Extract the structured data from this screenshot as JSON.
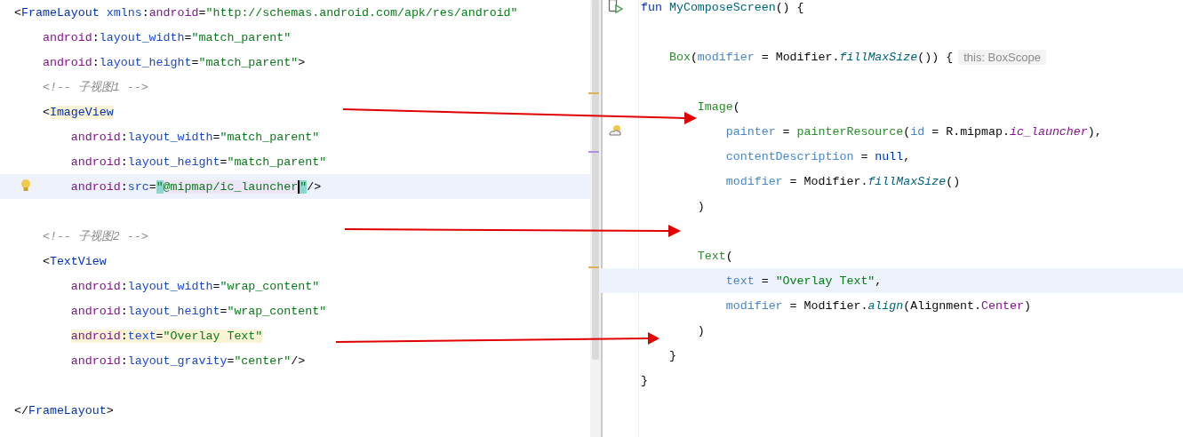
{
  "xml_editor": {
    "lines": [
      {
        "current": false,
        "marked": false,
        "tokens": [
          {
            "kind": "p",
            "text": "<"
          },
          {
            "kind": "tag",
            "text": "FrameLayout"
          },
          {
            "kind": "ns",
            "text": " xmlns"
          },
          {
            "kind": "p",
            "text": ":"
          },
          {
            "kind": "attr_ns",
            "text": "android"
          },
          {
            "kind": "p",
            "text": "="
          },
          {
            "kind": "str",
            "text": "\"http://schemas.android.com/apk/res/android\""
          }
        ]
      },
      {
        "current": false,
        "marked": false,
        "tokens": [
          {
            "kind": "attr_ns",
            "text": "    android"
          },
          {
            "kind": "p",
            "text": ":"
          },
          {
            "kind": "attr",
            "text": "layout_width"
          },
          {
            "kind": "p",
            "text": "="
          },
          {
            "kind": "str",
            "text": "\"match_parent\""
          }
        ]
      },
      {
        "current": false,
        "marked": false,
        "tokens": [
          {
            "kind": "attr_ns",
            "text": "    android"
          },
          {
            "kind": "p",
            "text": ":"
          },
          {
            "kind": "attr",
            "text": "layout_height"
          },
          {
            "kind": "p",
            "text": "="
          },
          {
            "kind": "str",
            "text": "\"match_parent\""
          },
          {
            "kind": "p",
            "text": ">"
          }
        ]
      },
      {
        "current": false,
        "marked": false,
        "tokens": [
          {
            "kind": "cm",
            "text": "    <!-- 子视图1 -->"
          }
        ]
      },
      {
        "current": false,
        "marked": true,
        "tokens": [
          {
            "kind": "p",
            "text": "    <"
          },
          {
            "kind": "tag",
            "text": "ImageView"
          }
        ]
      },
      {
        "current": false,
        "marked": false,
        "tokens": [
          {
            "kind": "attr_ns",
            "text": "        android"
          },
          {
            "kind": "p",
            "text": ":"
          },
          {
            "kind": "attr",
            "text": "layout_width"
          },
          {
            "kind": "p",
            "text": "="
          },
          {
            "kind": "str",
            "text": "\"match_parent\""
          }
        ]
      },
      {
        "current": false,
        "marked": false,
        "tokens": [
          {
            "kind": "attr_ns",
            "text": "        android"
          },
          {
            "kind": "p",
            "text": ":"
          },
          {
            "kind": "attr",
            "text": "layout_height"
          },
          {
            "kind": "p",
            "text": "="
          },
          {
            "kind": "str",
            "text": "\"match_parent\""
          }
        ]
      },
      {
        "current": true,
        "marked": false,
        "tokens": [
          {
            "kind": "attr_ns",
            "text": "        android"
          },
          {
            "kind": "p",
            "text": ":"
          },
          {
            "kind": "attr",
            "text": "src"
          },
          {
            "kind": "p",
            "text": "="
          },
          {
            "kind": "str_q",
            "text": "\""
          },
          {
            "kind": "str_sel",
            "text": "@mipmap/ic_launcher"
          },
          {
            "kind": "str_q",
            "text": "\""
          },
          {
            "kind": "p",
            "text": "/>"
          }
        ]
      },
      {
        "current": false
      },
      {
        "current": false,
        "marked": false,
        "tokens": [
          {
            "kind": "cm",
            "text": "    <!-- 子视图2 -->"
          }
        ]
      },
      {
        "current": false,
        "marked": false,
        "tokens": [
          {
            "kind": "p",
            "text": "    <"
          },
          {
            "kind": "tag",
            "text": "TextView"
          }
        ]
      },
      {
        "current": false,
        "marked": false,
        "tokens": [
          {
            "kind": "attr_ns",
            "text": "        android"
          },
          {
            "kind": "p",
            "text": ":"
          },
          {
            "kind": "attr",
            "text": "layout_width"
          },
          {
            "kind": "p",
            "text": "="
          },
          {
            "kind": "str",
            "text": "\"wrap_content\""
          }
        ]
      },
      {
        "current": false,
        "marked": false,
        "tokens": [
          {
            "kind": "attr_ns",
            "text": "        android"
          },
          {
            "kind": "p",
            "text": ":"
          },
          {
            "kind": "attr",
            "text": "layout_height"
          },
          {
            "kind": "p",
            "text": "="
          },
          {
            "kind": "str",
            "text": "\"wrap_content\""
          }
        ]
      },
      {
        "current": false,
        "marked": true,
        "tokens": [
          {
            "kind": "attr_ns",
            "text": "        android"
          },
          {
            "kind": "p",
            "text": ":"
          },
          {
            "kind": "attr",
            "text": "text"
          },
          {
            "kind": "p",
            "text": "="
          },
          {
            "kind": "str",
            "text": "\"Overlay Text\""
          }
        ]
      },
      {
        "current": false,
        "marked": false,
        "tokens": [
          {
            "kind": "attr_ns",
            "text": "        android"
          },
          {
            "kind": "p",
            "text": ":"
          },
          {
            "kind": "attr",
            "text": "layout_gravity"
          },
          {
            "kind": "p",
            "text": "="
          },
          {
            "kind": "str",
            "text": "\"center\""
          },
          {
            "kind": "p",
            "text": "/>"
          }
        ]
      },
      {
        "current": false
      },
      {
        "current": false,
        "marked": false,
        "tokens": [
          {
            "kind": "p",
            "text": "</"
          },
          {
            "kind": "tag",
            "text": "FrameLayout"
          },
          {
            "kind": "p",
            "text": ">"
          }
        ]
      }
    ]
  },
  "kotlin_editor": {
    "lines": [
      {
        "current": false,
        "tokens": [
          {
            "kind": "kw",
            "text": "fun"
          },
          {
            "kind": "fn",
            "text": " MyComposeScreen"
          },
          {
            "kind": "p",
            "text": "() {"
          }
        ]
      },
      {
        "current": false
      },
      {
        "current": false,
        "tokens": [
          {
            "kind": "call",
            "text": "    Box"
          },
          {
            "kind": "p",
            "text": "("
          },
          {
            "kind": "param",
            "text": "modifier"
          },
          {
            "kind": "p",
            "text": " = Modifier."
          },
          {
            "kind": "it",
            "text": "fillMaxSize"
          },
          {
            "kind": "p",
            "text": "()) {"
          }
        ],
        "hint": "this: BoxScope"
      },
      {
        "current": false
      },
      {
        "current": false,
        "tokens": [
          {
            "kind": "call",
            "text": "        Image"
          },
          {
            "kind": "p",
            "text": "("
          }
        ]
      },
      {
        "current": false,
        "tokens": [
          {
            "kind": "param",
            "text": "            painter"
          },
          {
            "kind": "p",
            "text": " = "
          },
          {
            "kind": "call",
            "text": "painterResource"
          },
          {
            "kind": "p",
            "text": "("
          },
          {
            "kind": "param",
            "text": "id"
          },
          {
            "kind": "p",
            "text": " = R.mipmap."
          },
          {
            "kind": "itp",
            "text": "ic_launcher"
          },
          {
            "kind": "p",
            "text": "),"
          }
        ]
      },
      {
        "current": false,
        "tokens": [
          {
            "kind": "param",
            "text": "            contentDescription"
          },
          {
            "kind": "p",
            "text": " = "
          },
          {
            "kind": "kw",
            "text": "null"
          },
          {
            "kind": "p",
            "text": ","
          }
        ]
      },
      {
        "current": false,
        "tokens": [
          {
            "kind": "param",
            "text": "            modifier"
          },
          {
            "kind": "p",
            "text": " = Modifier."
          },
          {
            "kind": "it",
            "text": "fillMaxSize"
          },
          {
            "kind": "p",
            "text": "()"
          }
        ]
      },
      {
        "current": false,
        "tokens": [
          {
            "kind": "p",
            "text": "        )"
          }
        ]
      },
      {
        "current": false
      },
      {
        "current": false,
        "tokens": [
          {
            "kind": "call",
            "text": "        Text"
          },
          {
            "kind": "p",
            "text": "("
          }
        ]
      },
      {
        "current": true,
        "tokens": [
          {
            "kind": "param",
            "text": "            text"
          },
          {
            "kind": "p",
            "text": " = "
          },
          {
            "kind": "str",
            "text": "\"Overlay Text\""
          },
          {
            "kind": "p",
            "text": ","
          }
        ]
      },
      {
        "current": false,
        "tokens": [
          {
            "kind": "param",
            "text": "            modifier"
          },
          {
            "kind": "p",
            "text": " = Modifier."
          },
          {
            "kind": "it",
            "text": "align"
          },
          {
            "kind": "p",
            "text": "(Alignment."
          },
          {
            "kind": "const",
            "text": "Center"
          },
          {
            "kind": "p",
            "text": ")"
          }
        ]
      },
      {
        "current": false,
        "tokens": [
          {
            "kind": "p",
            "text": "        )"
          }
        ]
      },
      {
        "current": false,
        "tokens": [
          {
            "kind": "p",
            "text": "    }"
          }
        ]
      },
      {
        "current": false,
        "tokens": [
          {
            "kind": "p",
            "text": "}"
          }
        ]
      }
    ]
  }
}
